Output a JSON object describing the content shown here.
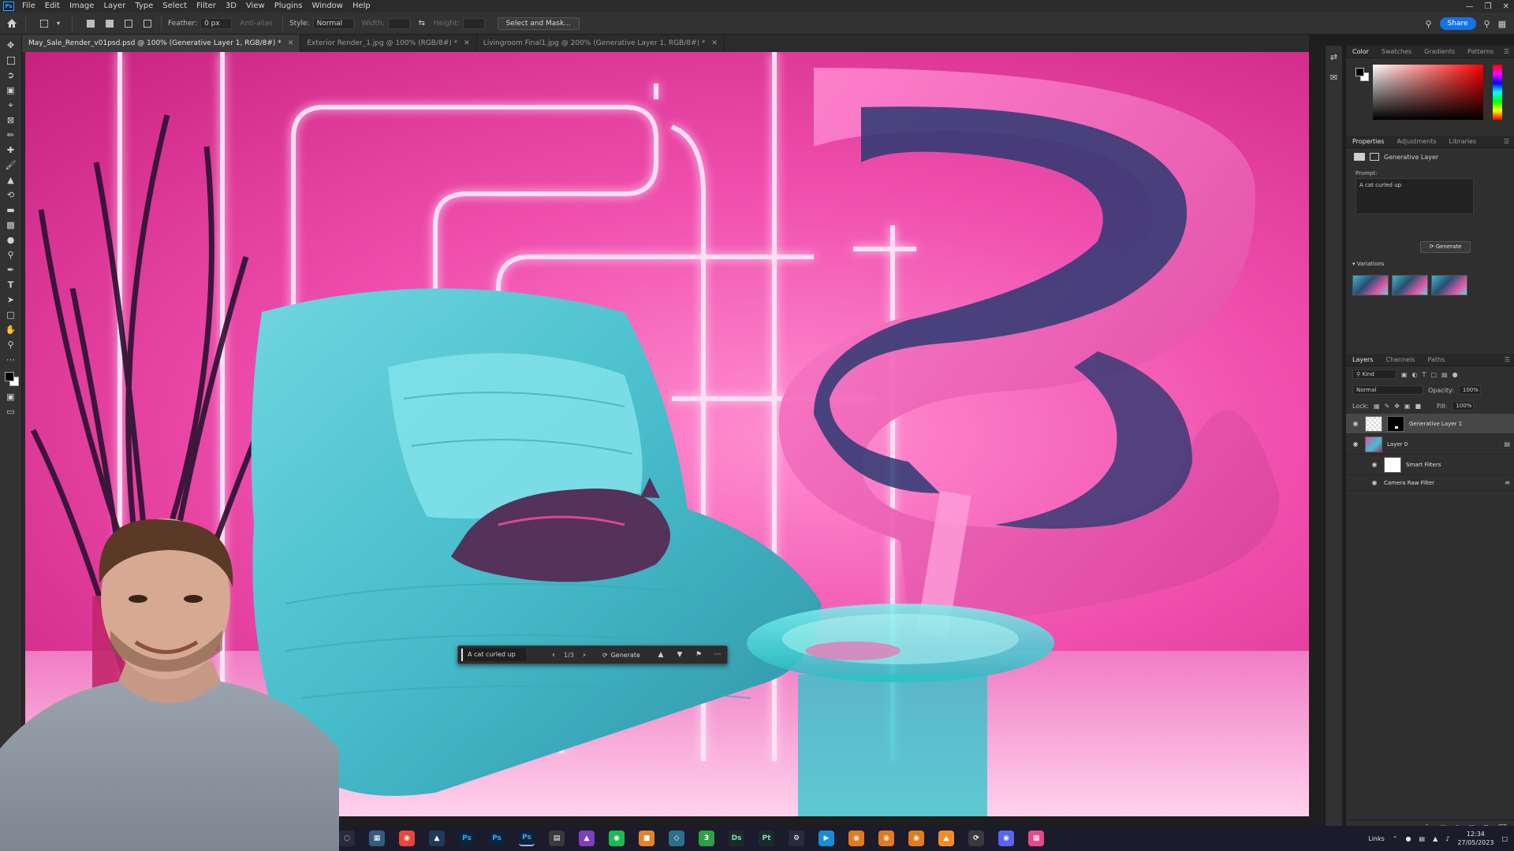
{
  "app": {
    "logo": "Ps",
    "menus": [
      "File",
      "Edit",
      "Image",
      "Layer",
      "Type",
      "Select",
      "Filter",
      "3D",
      "View",
      "Plugins",
      "Window",
      "Help"
    ]
  },
  "options": {
    "feather_label": "Feather:",
    "feather_value": "0 px",
    "antialias_label": "Anti-alias",
    "style_label": "Style:",
    "style_value": "Normal",
    "width_label": "Width:",
    "height_label": "Height:",
    "select_mask_label": "Select and Mask...",
    "share_label": "Share"
  },
  "tabs": [
    {
      "label": "May_Sale_Render_v01psd.psd @ 100% (Generative Layer 1, RGB/8#) *",
      "active": true
    },
    {
      "label": "Exterior Render_1.jpg @ 100% (RGB/8#) *",
      "active": false
    },
    {
      "label": "Livingroom Final1.jpg @ 200% (Generative Layer 1, RGB/8#) *",
      "active": false
    }
  ],
  "generative_bar": {
    "prompt": "A cat curled up",
    "counter": "1/3",
    "generate_label": "Generate"
  },
  "color_panel": {
    "tabs": [
      "Color",
      "Swatches",
      "Gradients",
      "Patterns"
    ]
  },
  "properties_panel": {
    "tabs": [
      "Properties",
      "Adjustments",
      "Libraries"
    ],
    "layer_type": "Generative Layer",
    "prompt_label": "Prompt:",
    "prompt_value": "A cat curled up",
    "generate_label": "Generate",
    "variations_label": "Variations"
  },
  "layers_panel": {
    "tabs": [
      "Layers",
      "Channels",
      "Paths"
    ],
    "kind_label": "Kind",
    "blend_mode": "Normal",
    "opacity_label": "Opacity:",
    "opacity_value": "100%",
    "lock_label": "Lock:",
    "fill_label": "Fill:",
    "fill_value": "100%",
    "layers": [
      {
        "name": "Generative Layer 1",
        "selected": true
      },
      {
        "name": "Layer 0",
        "selected": false
      },
      {
        "name": "Smart Filters",
        "selected": false
      },
      {
        "name": "Camera Raw Filter",
        "selected": false
      }
    ]
  },
  "taskbar": {
    "tray_label": "Links",
    "time": "12:34",
    "date": "27/05/2023"
  },
  "colors": {
    "accent": "#1473e6",
    "neon_pink": "#f04fae",
    "teal": "#3ec3d2"
  }
}
